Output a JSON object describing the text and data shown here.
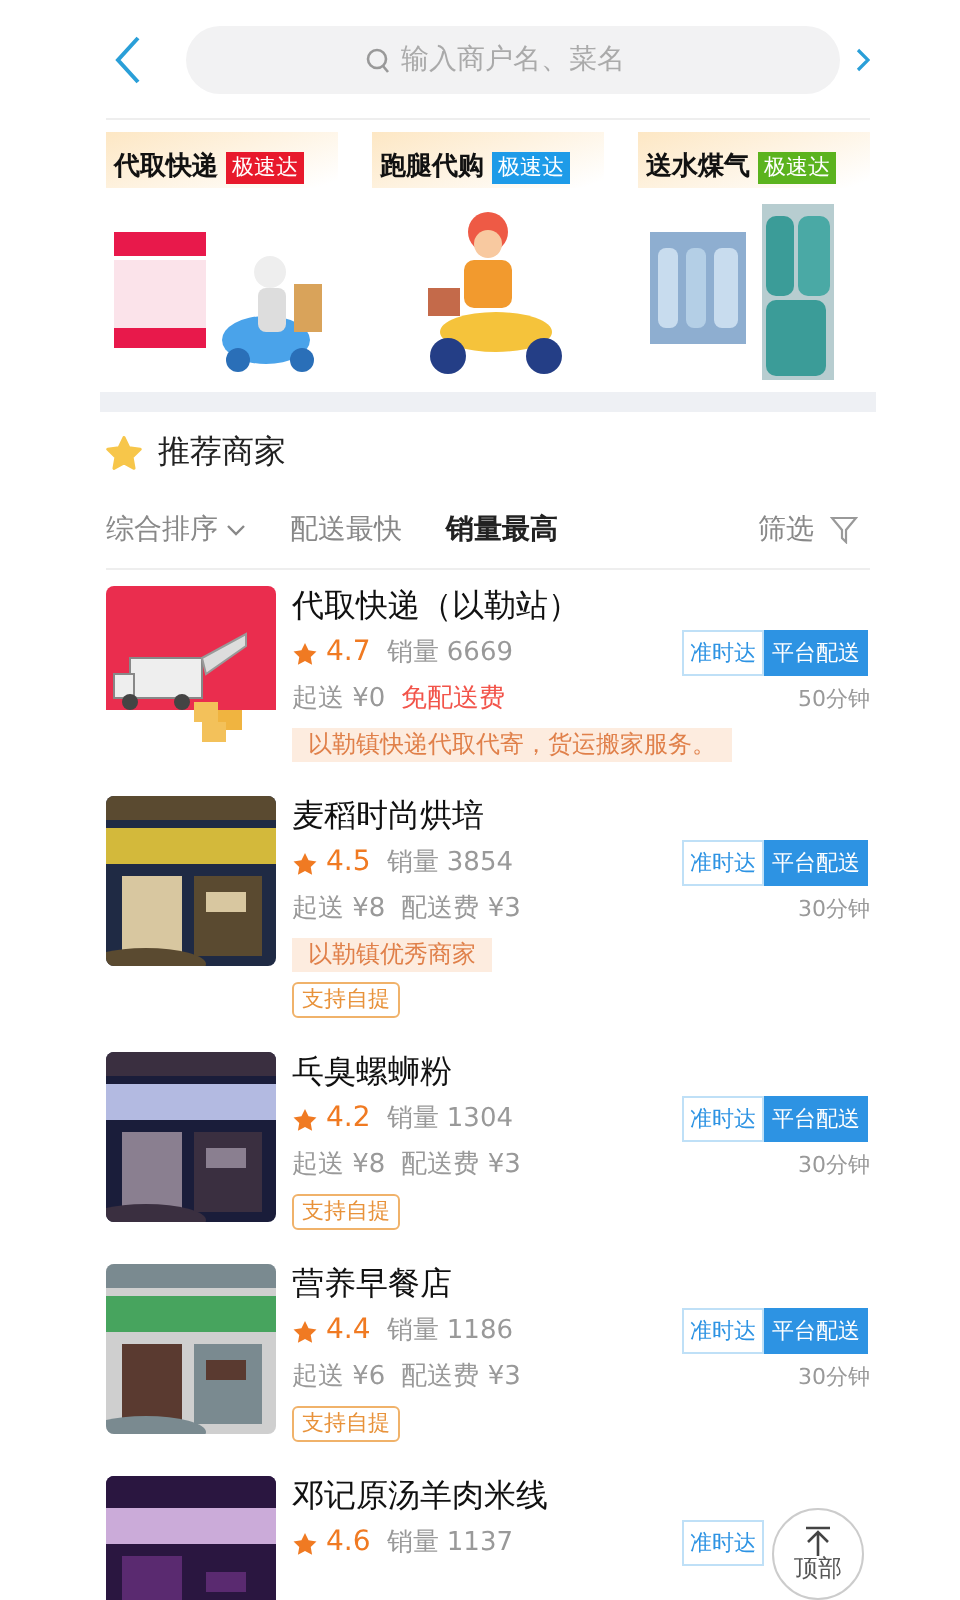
{
  "search": {
    "placeholder": "输入商户名、菜名"
  },
  "banners": [
    {
      "title": "代取快递",
      "badge": "极速达",
      "color": "#e8192c"
    },
    {
      "title": "跑腿代购",
      "badge": "极速达",
      "color": "#1e9be8"
    },
    {
      "title": "送水煤气",
      "badge": "极速达",
      "color": "#5bb31e"
    }
  ],
  "section": {
    "title": "推荐商家"
  },
  "sort_tabs": [
    {
      "label": "综合排序",
      "kind": "dropdown",
      "selected": false
    },
    {
      "label": "配送最快",
      "kind": "plain",
      "selected": false
    },
    {
      "label": "销量最高",
      "kind": "plain",
      "selected": true
    }
  ],
  "filter": {
    "label": "筛选"
  },
  "merchants": [
    {
      "name": "代取快递（以勒站）",
      "rating": "4.7",
      "sales": "销量 6669",
      "min_order": "起送 ¥0",
      "fee": "免配送费",
      "free_fee": true,
      "badges": [
        {
          "label": "准时达",
          "kind": "outline"
        },
        {
          "label": "平台配送",
          "kind": "solid"
        }
      ],
      "time": "50分钟",
      "notes": [
        "以勒镇快递代取代寄，货运搬家服务。"
      ]
    },
    {
      "name": "麦稻时尚烘培",
      "rating": "4.5",
      "sales": "销量 3854",
      "min_order": "起送 ¥8",
      "fee": "配送费 ¥3",
      "free_fee": false,
      "badges": [
        {
          "label": "准时达",
          "kind": "outline"
        },
        {
          "label": "平台配送",
          "kind": "solid"
        }
      ],
      "time": "30分钟",
      "notes": [
        "以勒镇优秀商家"
      ],
      "pickup": "支持自提"
    },
    {
      "name": "乓臭螺蛳粉",
      "rating": "4.2",
      "sales": "销量 1304",
      "min_order": "起送 ¥8",
      "fee": "配送费 ¥3",
      "free_fee": false,
      "badges": [
        {
          "label": "准时达",
          "kind": "outline"
        },
        {
          "label": "平台配送",
          "kind": "solid"
        }
      ],
      "time": "30分钟",
      "pickup": "支持自提"
    },
    {
      "name": "营养早餐店",
      "rating": "4.4",
      "sales": "销量 1186",
      "min_order": "起送 ¥6",
      "fee": "配送费 ¥3",
      "free_fee": false,
      "badges": [
        {
          "label": "准时达",
          "kind": "outline"
        },
        {
          "label": "平台配送",
          "kind": "solid"
        }
      ],
      "time": "30分钟",
      "pickup": "支持自提"
    },
    {
      "name": "邓记原汤羊肉米线",
      "rating": "4.6",
      "sales": "销量 1137",
      "badges": [
        {
          "label": "准时达",
          "kind": "outline"
        }
      ]
    }
  ],
  "top_button": {
    "label": "顶部"
  }
}
